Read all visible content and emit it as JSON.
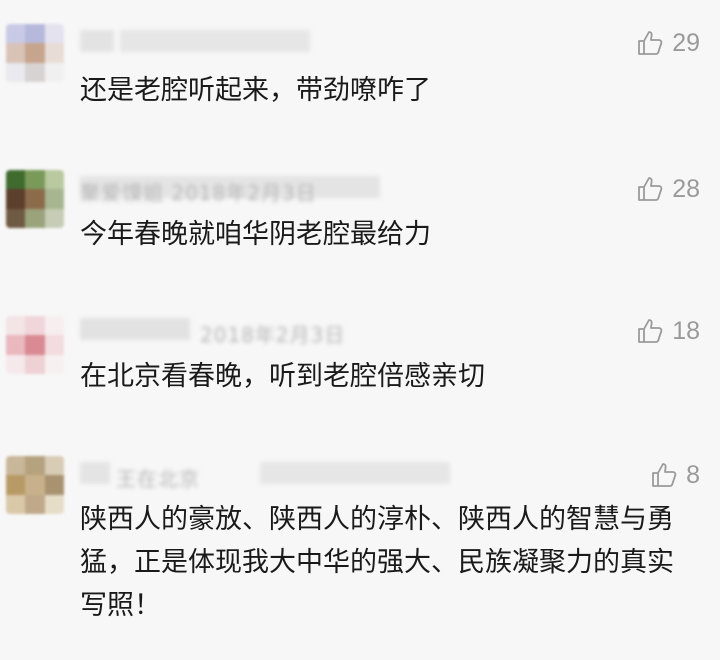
{
  "comments": [
    {
      "likes": "29",
      "text": "还是老腔听起来，带劲嘹咋了",
      "avatar_colors": [
        "#c9cbe6",
        "#b7b9dc",
        "#e4e2ef",
        "#d9c3b7",
        "#c6a58e",
        "#e8ddd6",
        "#e9e9ef",
        "#d8d3d3",
        "#f0f0f0"
      ],
      "meta_visible": ""
    },
    {
      "likes": "28",
      "text": "今年春晚就咱华阴老腔最给力",
      "avatar_colors": [
        "#3f6b2f",
        "#7a9a59",
        "#b9c9a0",
        "#5c3f2c",
        "#8c6b4b",
        "#a7b590",
        "#6f5a44",
        "#9aa37c",
        "#c6ccb5"
      ],
      "meta_visible": "聚爱馍姐  2018年2月3日"
    },
    {
      "likes": "18",
      "text": "在北京看春晚，听到老腔倍感亲切",
      "avatar_colors": [
        "#f3e4e6",
        "#f0d6da",
        "#f7eef0",
        "#eab8bf",
        "#d98a92",
        "#f2dcdf",
        "#f5e9eb",
        "#eed1d4",
        "#f7f0f1"
      ],
      "meta_visible": "2018年2月3日"
    },
    {
      "likes": "8",
      "text": "陕西人的豪放、陕西人的淳朴、陕西人的智慧与勇猛，正是体现我大中华的强大、民族凝聚力的真实写照！",
      "avatar_colors": [
        "#c9b79a",
        "#b5a27e",
        "#d8ccb6",
        "#b89a66",
        "#c8b08a",
        "#a89270",
        "#d9c9a9",
        "#bfa98a",
        "#e6ddc9"
      ],
      "meta_visible": "王在北京"
    }
  ]
}
